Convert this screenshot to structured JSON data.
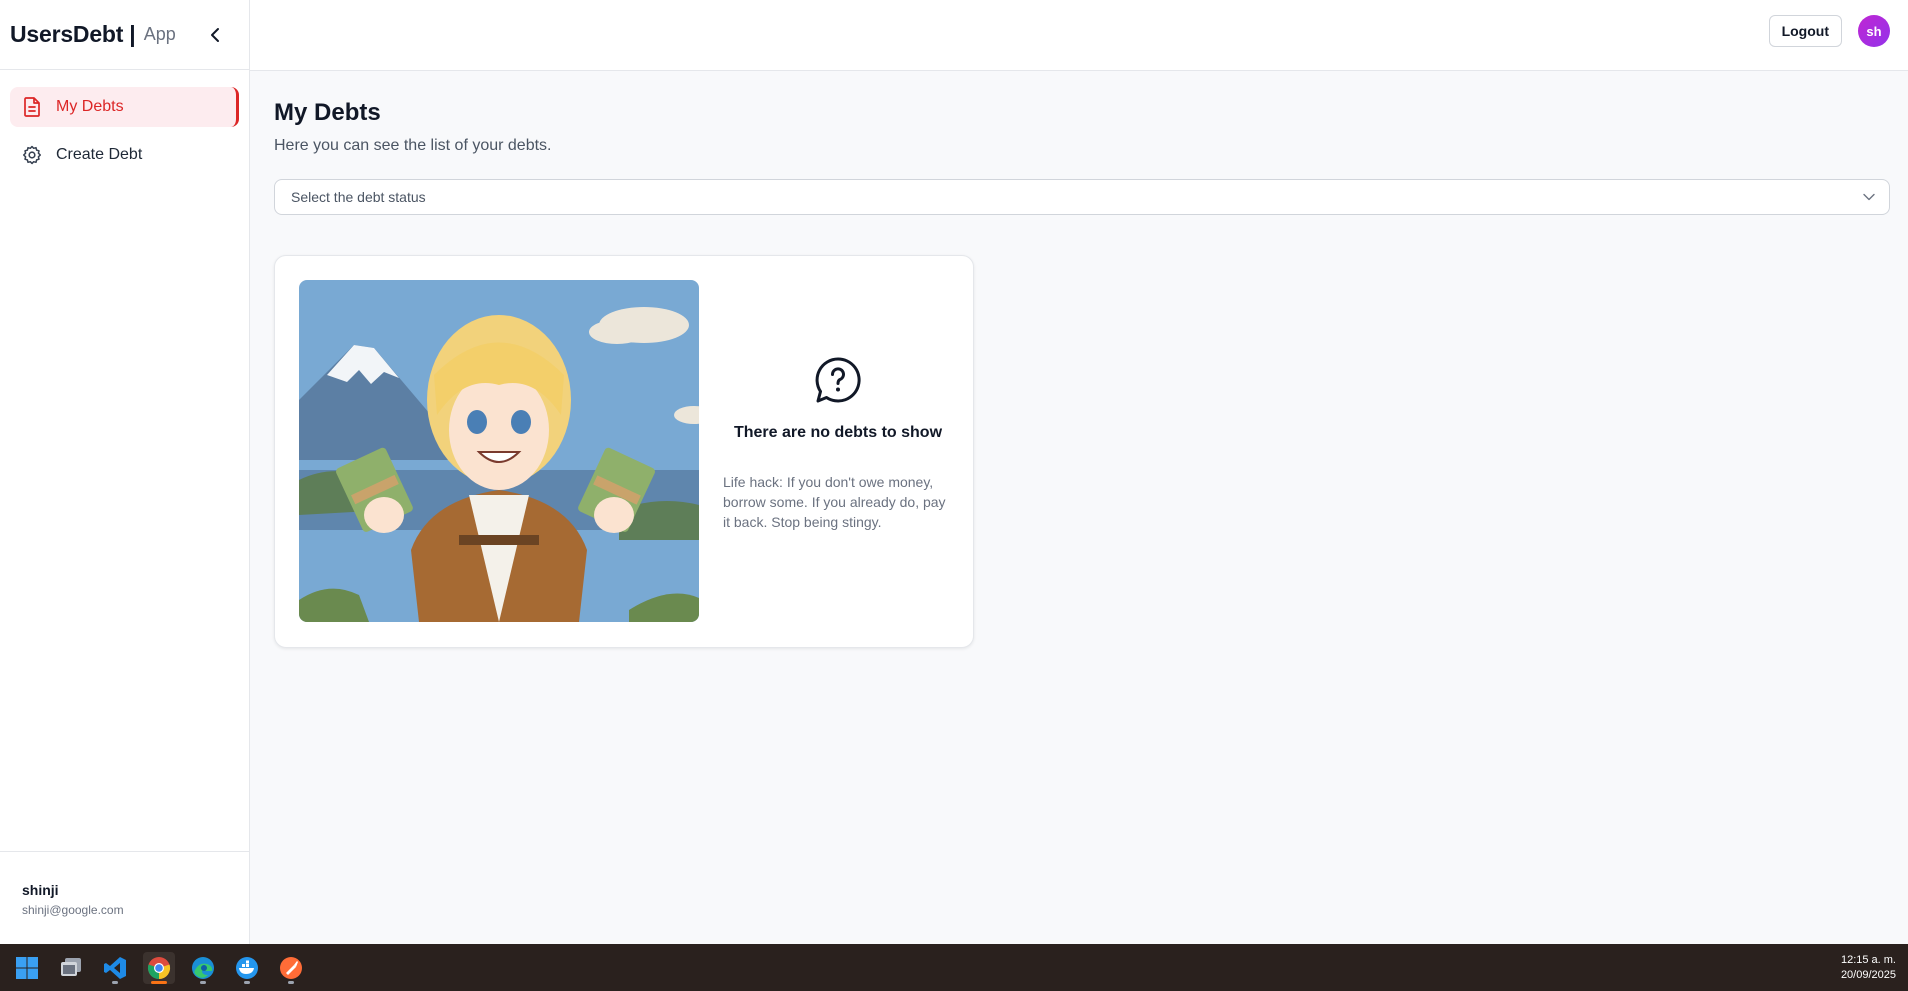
{
  "brand": {
    "name": "UsersDebt",
    "separator": "|",
    "sub": "App"
  },
  "sidebar": {
    "items": [
      {
        "label": "My Debts",
        "icon": "document-icon",
        "active": true
      },
      {
        "label": "Create Debt",
        "icon": "gear-icon",
        "active": false
      }
    ],
    "user": {
      "name": "shinji",
      "email": "shinji@google.com"
    }
  },
  "topbar": {
    "logout_label": "Logout",
    "avatar_initials": "sh"
  },
  "main": {
    "title": "My Debts",
    "subtitle": "Here you can see the list of your debts.",
    "status_select": {
      "placeholder": "Select the debt status"
    },
    "empty_state": {
      "icon": "question-bubble-icon",
      "title": "There are no debts to show",
      "text": "Life hack: If you don't owe money, borrow some. If you already do, pay it back. Stop being stingy."
    }
  },
  "taskbar": {
    "apps": [
      "windows-start-icon",
      "file-explorer-icon",
      "vscode-icon",
      "chrome-icon",
      "edge-icon",
      "docker-icon",
      "postman-icon"
    ],
    "time": "12:15 a. m.",
    "date": "20/09/2025"
  },
  "colors": {
    "accent": "#dc2626",
    "active_bg": "#fdecef",
    "avatar": "#c026d3",
    "taskbar": "#2a211e"
  }
}
